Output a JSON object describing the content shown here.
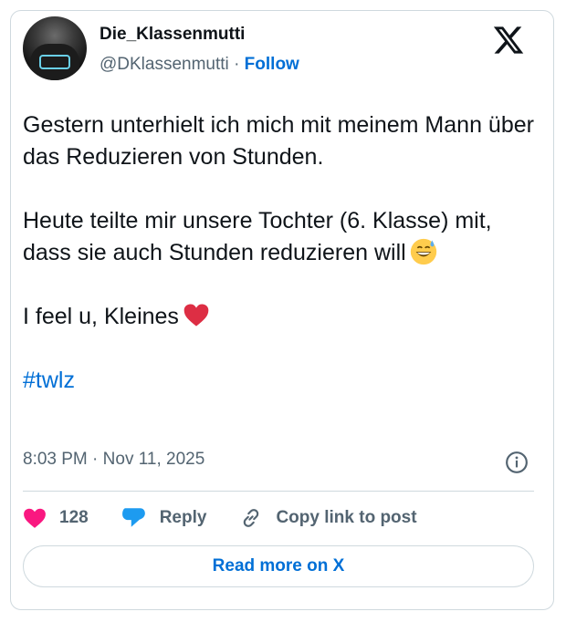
{
  "author": {
    "display_name": "Die_Klassenmutti",
    "handle": "@DKlassenmutti",
    "separator": "·",
    "follow_label": "Follow"
  },
  "tweet": {
    "paragraph1": "Gestern unterhielt ich mich mit meinem Mann über das Reduzieren von Stunden.",
    "paragraph2": "Heute teilte mir unsere Tochter (6. Klasse) mit, dass sie auch Stunden reduzieren will",
    "paragraph2_emoji": "grinning-face-with-sweat",
    "paragraph3": "I feel u, Kleines",
    "paragraph3_emoji": "red-heart",
    "hashtag": "#twlz"
  },
  "meta": {
    "time": "8:03 PM",
    "separator": "·",
    "date": "Nov 11, 2025"
  },
  "actions": {
    "like_count": "128",
    "reply_label": "Reply",
    "copy_label": "Copy link to post"
  },
  "read_more_label": "Read more on X",
  "colors": {
    "link_blue": "#006fd6",
    "like_pink": "#f91880",
    "reply_blue": "#1d9bf0",
    "secondary_text": "#536471",
    "border": "#cfd9de"
  },
  "icons": [
    "x-logo-icon",
    "info-icon",
    "heart-icon",
    "reply-bubble-icon",
    "link-icon"
  ]
}
